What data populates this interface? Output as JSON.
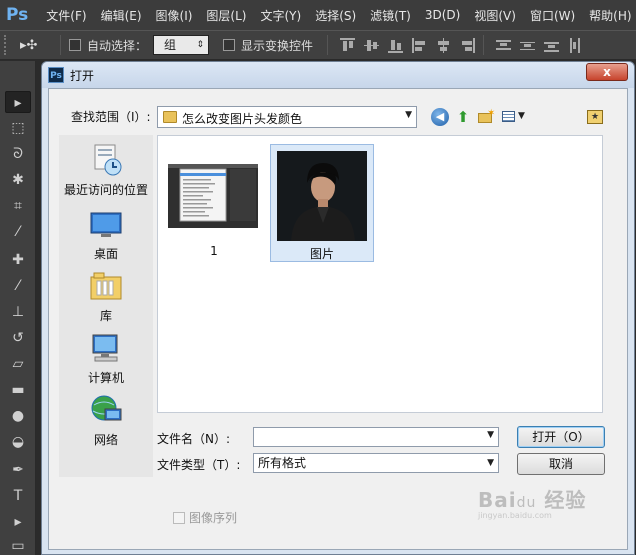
{
  "app": {
    "logo": "Ps",
    "menu": [
      "文件(F)",
      "编辑(E)",
      "图像(I)",
      "图层(L)",
      "文字(Y)",
      "选择(S)",
      "滤镜(T)",
      "3D(D)",
      "视图(V)",
      "窗口(W)",
      "帮助(H)"
    ]
  },
  "options_bar": {
    "auto_select_label": "自动选择：",
    "auto_select_value": "组",
    "show_transform_label": "显示变换控件"
  },
  "toolbox": {
    "tools": [
      "move-tool",
      "marquee-tool",
      "lasso-tool",
      "magic-wand-tool",
      "crop-tool",
      "eyedropper-tool",
      "healing-tool",
      "brush-tool",
      "clone-stamp-tool",
      "history-brush-tool",
      "eraser-tool",
      "gradient-tool",
      "blur-tool",
      "dodge-tool",
      "pen-tool",
      "type-tool",
      "path-select-tool",
      "shape-tool"
    ]
  },
  "dialog": {
    "title": "打开",
    "close_label": "x",
    "look_in_label": "查找范围（I）:",
    "look_in_value": "怎么改变图片头发颜色",
    "places": [
      {
        "label": "最近访问的位置",
        "icon": "recent-places-icon"
      },
      {
        "label": "桌面",
        "icon": "desktop-icon"
      },
      {
        "label": "库",
        "icon": "libraries-icon"
      },
      {
        "label": "计算机",
        "icon": "computer-icon"
      },
      {
        "label": "网络",
        "icon": "network-icon"
      }
    ],
    "files": [
      {
        "label": "1",
        "selected": false
      },
      {
        "label": "图片",
        "selected": true
      }
    ],
    "file_name_label": "文件名（N）:",
    "file_name_value": "",
    "file_type_label": "文件类型（T）:",
    "file_type_value": "所有格式",
    "open_button": "打开（O）",
    "cancel_button": "取消",
    "image_sequence_label": "图像序列"
  },
  "watermark": {
    "brand": "Bai",
    "brand_suffix": "du",
    "text": "经验",
    "url": "jingyan.baidu.com"
  }
}
